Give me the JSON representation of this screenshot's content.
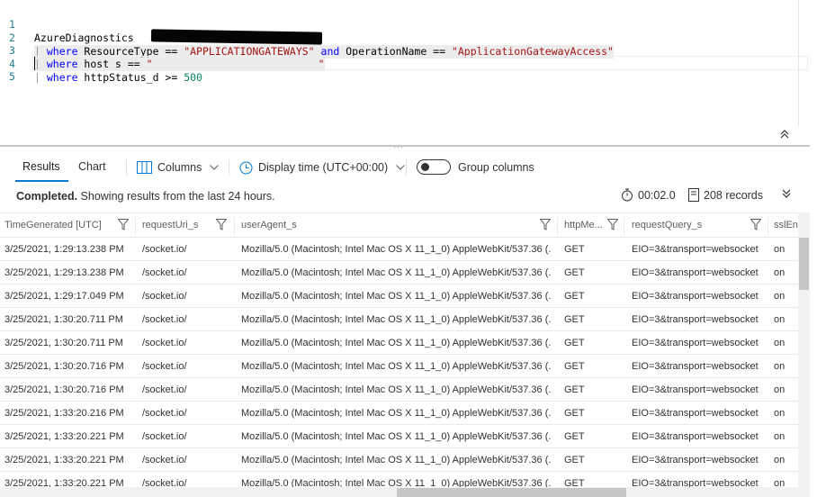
{
  "editor": {
    "lines": [
      {
        "num": "1",
        "text": "AzureDiagnostics"
      },
      {
        "num": "2",
        "pipe": "|",
        "kw1": "where",
        "mid1": " ResourceType == ",
        "str1": "\"APPLICATIONGATEWAYS\"",
        "kw2": "and",
        "mid2": " OperationName == ",
        "str2": "\"ApplicationGatewayAccess\""
      },
      {
        "num": "3",
        "pipe": "|",
        "kw1": "where",
        "mid1": " host_s == ",
        "str1": "\"",
        "str2": "\""
      },
      {
        "num": "4",
        "pipe": "|",
        "kw1": "where",
        "mid1": " httpStatus_d >= ",
        "numval": "500"
      },
      {
        "num": "5"
      }
    ]
  },
  "toolbar": {
    "tab_results": "Results",
    "tab_chart": "Chart",
    "columns_label": "Columns",
    "display_time_label": "Display time (UTC+00:00)",
    "group_columns_label": "Group columns"
  },
  "status": {
    "completed": "Completed.",
    "message": " Showing results from the last 24 hours.",
    "duration": "00:02.0",
    "records": "208 records"
  },
  "grid": {
    "columns": [
      "TimeGenerated [UTC]",
      "requestUri_s",
      "userAgent_s",
      "httpMe...",
      "requestQuery_s",
      "sslEna"
    ],
    "rows": [
      [
        "3/25/2021, 1:29:13.238 PM",
        "/socket.io/",
        "Mozilla/5.0 (Macintosh; Intel Mac OS X 11_1_0) AppleWebKit/537.36 (...",
        "GET",
        "EIO=3&transport=websocket",
        "on"
      ],
      [
        "3/25/2021, 1:29:13.238 PM",
        "/socket.io/",
        "Mozilla/5.0 (Macintosh; Intel Mac OS X 11_1_0) AppleWebKit/537.36 (...",
        "GET",
        "EIO=3&transport=websocket",
        "on"
      ],
      [
        "3/25/2021, 1:29:17.049 PM",
        "/socket.io/",
        "Mozilla/5.0 (Macintosh; Intel Mac OS X 11_1_0) AppleWebKit/537.36 (...",
        "GET",
        "EIO=3&transport=websocket",
        "on"
      ],
      [
        "3/25/2021, 1:30:20.711 PM",
        "/socket.io/",
        "Mozilla/5.0 (Macintosh; Intel Mac OS X 11_1_0) AppleWebKit/537.36 (...",
        "GET",
        "EIO=3&transport=websocket",
        "on"
      ],
      [
        "3/25/2021, 1:30:20.711 PM",
        "/socket.io/",
        "Mozilla/5.0 (Macintosh; Intel Mac OS X 11_1_0) AppleWebKit/537.36 (...",
        "GET",
        "EIO=3&transport=websocket",
        "on"
      ],
      [
        "3/25/2021, 1:30:20.716 PM",
        "/socket.io/",
        "Mozilla/5.0 (Macintosh; Intel Mac OS X 11_1_0) AppleWebKit/537.36 (...",
        "GET",
        "EIO=3&transport=websocket",
        "on"
      ],
      [
        "3/25/2021, 1:30:20.716 PM",
        "/socket.io/",
        "Mozilla/5.0 (Macintosh; Intel Mac OS X 11_1_0) AppleWebKit/537.36 (...",
        "GET",
        "EIO=3&transport=websocket",
        "on"
      ],
      [
        "3/25/2021, 1:33:20.216 PM",
        "/socket.io/",
        "Mozilla/5.0 (Macintosh; Intel Mac OS X 11_1_0) AppleWebKit/537.36 (...",
        "GET",
        "EIO=3&transport=websocket",
        "on"
      ],
      [
        "3/25/2021, 1:33:20.221 PM",
        "/socket.io/",
        "Mozilla/5.0 (Macintosh; Intel Mac OS X 11_1_0) AppleWebKit/537.36 (...",
        "GET",
        "EIO=3&transport=websocket",
        "on"
      ],
      [
        "3/25/2021, 1:33:20.221 PM",
        "/socket.io/",
        "Mozilla/5.0 (Macintosh; Intel Mac OS X 11_1_0) AppleWebKit/537.36 (...",
        "GET",
        "EIO=3&transport=websocket",
        "on"
      ],
      [
        "3/25/2021, 1:33:20.221 PM",
        "/socket.io/",
        "Mozilla/5.0 (Macintosh; Intel Mac OS X 11_1_0) AppleWebKit/537.36 (...",
        "GET",
        "EIO=3&transport=websocket",
        "on"
      ]
    ]
  },
  "colors": {
    "accent": "#0078d4",
    "keyword": "#0000ff",
    "string": "#a31515",
    "number": "#098658",
    "line_number": "#237893"
  }
}
